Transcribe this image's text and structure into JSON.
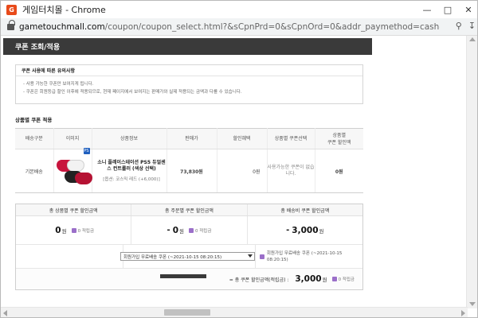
{
  "window": {
    "title": "게임터치몰 - Chrome",
    "icon_letter": "G",
    "url_host": "gametouchmall.com",
    "url_path": "/coupon/coupon_select.html?&sCpnPrd=0&sCpnOrd=0&addr_paymethod=cash&f..."
  },
  "popup": {
    "header": "쿠폰 조회/적용",
    "notice": {
      "title": "쿠폰 사용에 따른 유의사항",
      "items": [
        "- 사용 가능한 쿠폰만 보여지게 됩니다.",
        "- 쿠폰은 회원등급 할인 이후에 적용되므로, 현재 페이지에서 보여지는 판매가와 실제 적용되는 금액과 다를 수 있습니다."
      ]
    },
    "product_section_title": "상품별 쿠폰 적용",
    "table": {
      "headers": [
        "배송구분",
        "이미지",
        "상품정보",
        "판매가",
        "할인혜택",
        "상품별 쿠폰선택",
        "상품별\n쿠폰 할인액"
      ],
      "row": {
        "delivery": "기본배송",
        "badge": "PS",
        "name": "소니 플레이스테이션 PS5 듀얼센스 컨트롤러 (색상 선택)",
        "option": "[옵션: 코스믹 레드 (+6,000)]",
        "price": "73,830원",
        "discount": "0원",
        "coupon_select": "사용가능한 쿠폰이 없습니다.",
        "coupon_discount": "0원"
      }
    },
    "summary": {
      "headers": [
        "총 상품별 쿠폰 할인금액",
        "총 주문별 쿠폰 할인금액",
        "총 배송비 쿠폰 할인금액"
      ],
      "values": [
        {
          "prefix": "",
          "amount": "0",
          "unit": "원",
          "points": "0 적립금"
        },
        {
          "prefix": "-",
          "amount": "0",
          "unit": "원",
          "points": "0 적립금"
        },
        {
          "prefix": "-",
          "amount": "3,000",
          "unit": "원",
          "points": ""
        }
      ],
      "order_coupon_select": "회원가입 무료배송 쿠폰 (~2021-10-15 08:20:15)",
      "delivery_coupon_text": "회원가입 무료배송 쿠폰 (~2021-10-15 08:20:15)",
      "total_label": "= 총 쿠폰 할인금액(적립금) :",
      "total_amount": "3,000",
      "total_unit": "원",
      "total_points": "0 적립금"
    }
  },
  "colors": {
    "popup_header_bg": "#3a3a3a",
    "points_icon": "#9b6fc9"
  }
}
